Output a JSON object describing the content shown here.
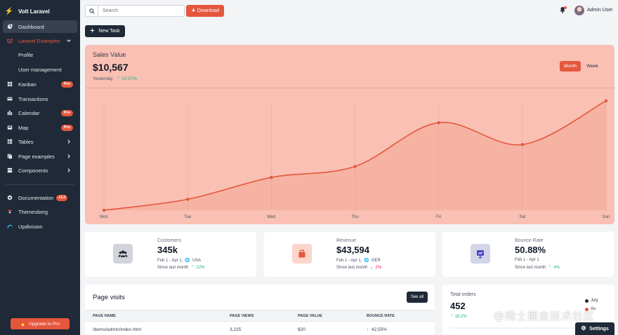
{
  "colors": {
    "accent": "#e4573d",
    "sidebar": "#1f2937",
    "success": "#10b981",
    "danger": "#e11d48"
  },
  "sidebar": {
    "brand": "Volt Laravel",
    "items": [
      {
        "label": "Dashboard",
        "icon": "pie-chart-icon"
      },
      {
        "label": "Laravel Examples",
        "icon": "laravel-icon"
      },
      {
        "label": "Profile"
      },
      {
        "label": "User management"
      },
      {
        "label": "Kanban",
        "icon": "kanban-icon",
        "badge": "Pro"
      },
      {
        "label": "Transactions",
        "icon": "credit-card-icon"
      },
      {
        "label": "Calendar",
        "icon": "calendar-icon",
        "badge": "Pro"
      },
      {
        "label": "Map",
        "icon": "map-icon",
        "badge": "Pro"
      },
      {
        "label": "Tables",
        "icon": "table-icon"
      },
      {
        "label": "Page examples",
        "icon": "pages-icon"
      },
      {
        "label": "Components",
        "icon": "components-icon"
      }
    ],
    "footer_items": [
      {
        "label": "Documentation",
        "icon": "book-icon",
        "badge": "v1.0"
      },
      {
        "label": "Themesberg",
        "icon": "themesberg-logo-icon"
      },
      {
        "label": "Updivision",
        "icon": "updivision-logo-icon"
      }
    ],
    "upgrade_label": "Upgrade to Pro"
  },
  "topbar": {
    "search_placeholder": "Search",
    "download_label": "Download",
    "user_name": "Admin User"
  },
  "actions": {
    "new_task_label": "New Task"
  },
  "sales": {
    "title": "Sales Value",
    "value": "$10,567",
    "period_label": "Yesterday",
    "change": "10.57%",
    "toggle_month": "Month",
    "toggle_week": "Week"
  },
  "chart_data": {
    "type": "line",
    "categories": [
      "Mon",
      "Tue",
      "Wed",
      "Thu",
      "Fri",
      "Sat",
      "Sun"
    ],
    "values": [
      0,
      10,
      30,
      40,
      80,
      60,
      100
    ],
    "ylim": [
      0,
      105
    ],
    "grid": true,
    "fill": true
  },
  "stats": [
    {
      "title": "Customers",
      "value": "345k",
      "date": "Feb 1 - Apr 1,",
      "region": "USA",
      "compare": "Since last month",
      "change": "22%",
      "direction": "up",
      "icon": "users-icon"
    },
    {
      "title": "Revenue",
      "value": "$43,594",
      "date": "Feb 1 - Apr 1,",
      "region": "GER",
      "compare": "Since last month",
      "change": "2%",
      "direction": "down",
      "icon": "shopping-bag-icon"
    },
    {
      "title": "Bounce Rate",
      "value": "50.88%",
      "date": "Feb 1 - Apr 1",
      "compare": "Since last month",
      "change": "4%",
      "direction": "up",
      "icon": "presentation-chart-icon"
    }
  ],
  "visits": {
    "title": "Page visits",
    "see_all_label": "See all",
    "columns": [
      "PAGE NAME",
      "PAGE VIEWS",
      "PAGE VALUE",
      "BOUNCE RATE"
    ],
    "rows": [
      {
        "page": "/demo/admin/index.html",
        "views": "3,225",
        "value": "$20",
        "bounce": "42,55%"
      }
    ]
  },
  "orders": {
    "title": "Total orders",
    "value": "452",
    "change": "18.2%",
    "legend": [
      {
        "label": "July",
        "color": "#1f2937"
      },
      {
        "label": "Au",
        "color": "#e4573d"
      }
    ]
  },
  "watermark": "@稀土掘金技术社区",
  "settings_label": "Settings"
}
